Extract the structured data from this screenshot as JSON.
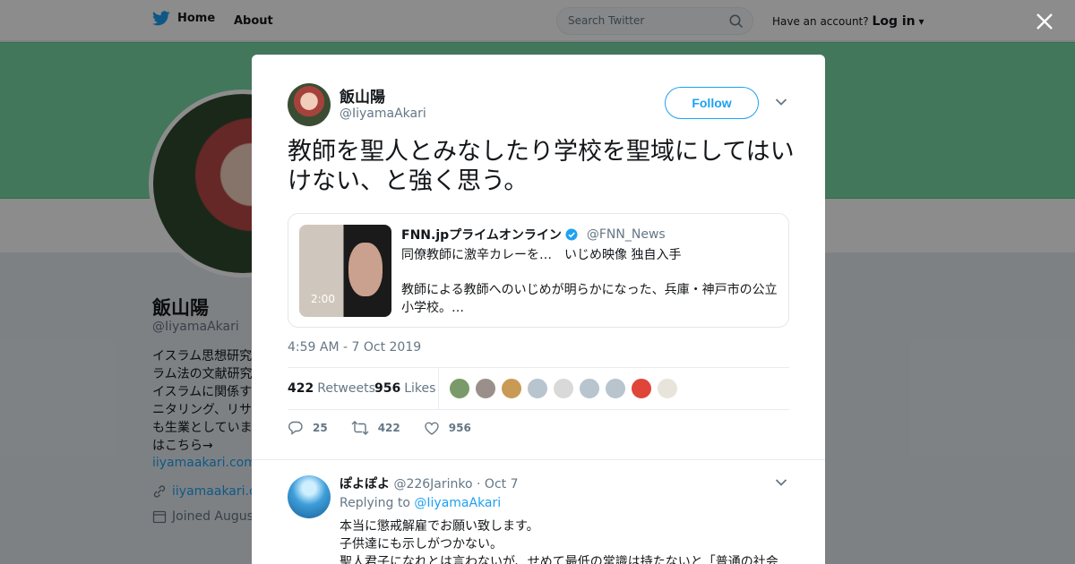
{
  "topbar": {
    "home_label": "Home",
    "about_label": "About",
    "search_placeholder": "Search Twitter",
    "account_prompt": "Have an account?",
    "login_label": "Log in"
  },
  "profile": {
    "name": "飯山陽",
    "handle": "@IiyamaAkari",
    "bio": "イスラム思想研究 ラム法の文献研究 イスラムに関係す ニタリング、リサ も生業としていま はこちら→",
    "bio_link": "iiyamaakari.com/2",
    "website": "iiyamaakari.co",
    "joined": "Joined August"
  },
  "colors": {
    "accent": "#1da1f2",
    "banner": "#78d9a8",
    "text": "#14171a",
    "muted": "#657786"
  },
  "tweet": {
    "author_name": "飯山陽",
    "author_handle": "@IiyamaAkari",
    "follow_label": "Follow",
    "text": "教師を聖人とみなしたり学校を聖域にしてはいけない、と強く思う。",
    "card": {
      "duration": "2:00",
      "source_name": "FNN.jpプライムオンライン",
      "source_handle": "@FNN_News",
      "title": "同僚教師に激辛カレーを…　いじめ映像 独自入手",
      "description": "教師による教師へのいじめが明らかになった、兵庫・神戸市の公立小学校。…"
    },
    "timestamp": "4:59 AM - 7 Oct 2019",
    "retweets_count": "422",
    "retweets_label": "Retweets",
    "likes_count": "956",
    "likes_label": "Likes",
    "liker_colors": [
      "#7a9a6a",
      "#9a8f8a",
      "#c99a55",
      "#b8c4ce",
      "#d9d9d9",
      "#b8c4ce",
      "#b8c4ce",
      "#e0453a",
      "#e8e4dc"
    ],
    "actions": {
      "reply_count": "25",
      "retweet_count": "422",
      "like_count": "956"
    }
  },
  "reply": {
    "name": "ぽよぽよ",
    "handle": "@226Jarinko",
    "date": "· Oct 7",
    "replying_prefix": "Replying to",
    "replying_to": "@IiyamaAkari",
    "line1": "本当に懲戒解雇でお願い致します。",
    "line2": "子供達にも示しがつかない。",
    "line3": "聖人君子になれとは言わないが、せめて最低の常識は持たないと「普通の社会"
  }
}
